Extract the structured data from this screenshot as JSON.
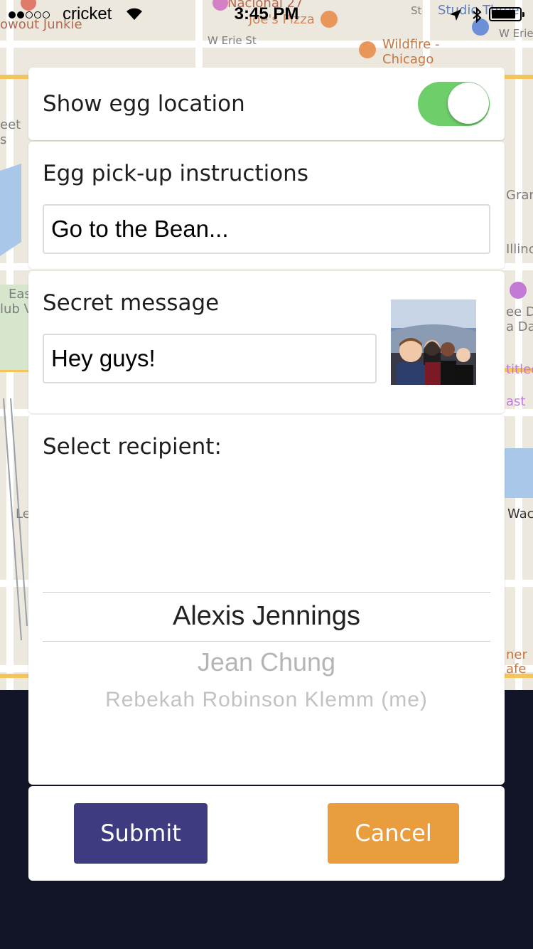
{
  "status_bar": {
    "carrier": "cricket",
    "time": "3:45 PM"
  },
  "map_labels": [
    "owout Junkie",
    "Nacional 27",
    "Joe's Pizza",
    "W Erie St",
    "Wildfire -",
    "Chicago",
    "Studio Three",
    "W Erie",
    "eet",
    "s",
    "Gran",
    "Illinc",
    "Eas",
    "lub V",
    "ee D",
    "a Da",
    "titled",
    "ast",
    "Le",
    "Wac",
    "ner",
    "afe",
    "St"
  ],
  "toggle_card": {
    "label": "Show egg location",
    "toggle_on": true,
    "toggle_color": "#6ecf6a"
  },
  "instructions_card": {
    "label": "Egg pick-up instructions",
    "value": "Go to the Bean..."
  },
  "message_card": {
    "label": "Secret message",
    "value": "Hey guys!",
    "photo_icon": "selfie-photo"
  },
  "recipient_card": {
    "label": "Select recipient:",
    "options": [
      "Alexis Jennings",
      "Jean Chung",
      "Rebekah Robinson Klemm (me)"
    ],
    "selected": "Alexis Jennings"
  },
  "actions": {
    "submit_label": "Submit",
    "cancel_label": "Cancel",
    "submit_color": "#3f3b80",
    "cancel_color": "#ea9d3c"
  }
}
